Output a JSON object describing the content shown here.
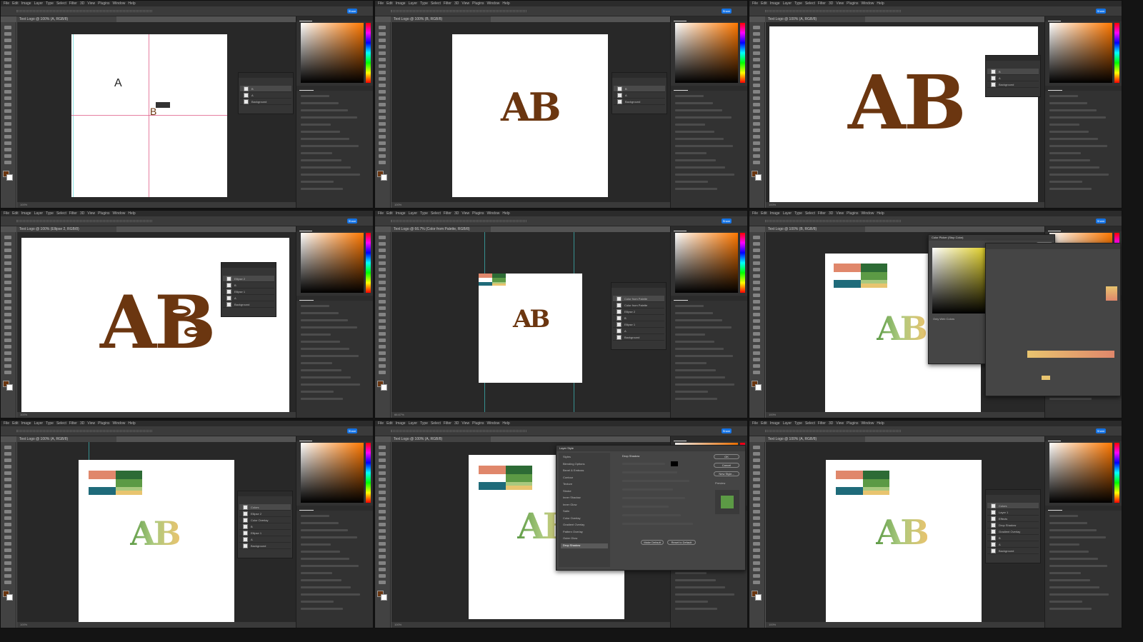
{
  "menu": [
    "File",
    "Edit",
    "Image",
    "Layer",
    "Type",
    "Select",
    "Filter",
    "3D",
    "View",
    "Plugins",
    "Window",
    "Help"
  ],
  "share_label": "Share",
  "panes": [
    {
      "tab": "Text Logo @ 100% (A, RGB/8)",
      "status": "100%",
      "layers": [
        "B",
        "A",
        "Background"
      ],
      "letters": {
        "a": "A",
        "b": "B"
      }
    },
    {
      "tab": "Text Logo @ 100% (B, RGB/8)",
      "status": "100%",
      "layers": [
        "B",
        "A",
        "Background"
      ],
      "logo": "AB"
    },
    {
      "tab": "Text Logo @ 100% (A, RGB/8)",
      "status": "100%",
      "layers": [
        "B",
        "A",
        "Background"
      ],
      "logo": "AB"
    },
    {
      "tab": "Text Logo @ 100% (Ellipse 2, RGB/8)",
      "status": "100%",
      "layers": [
        "Ellipse 2",
        "B",
        "Ellipse 1",
        "A",
        "Background"
      ],
      "logo": "AB"
    },
    {
      "tab": "Text Logo @ 66.7% (Color from Palette, RGB/8)",
      "status": "66.67%",
      "layers": [
        "Color from Palette",
        "Color from Palette",
        "Ellipse 2",
        "B",
        "Ellipse 1",
        "A",
        "Background"
      ],
      "logo": "AB"
    },
    {
      "tab": "Text Logo @ 100% (B, RGB/8)",
      "status": "100%",
      "logo": "AB",
      "dialog": {
        "title": "Color Picker (Stop Color)",
        "ok": "OK",
        "cancel": "Cancel",
        "add": "Add to Swatches",
        "libs": "Color Libraries",
        "only_web": "Only Web Colors",
        "hex": "E8C46F",
        "fields": [
          "H:",
          "S:",
          "B:",
          "R:",
          "G:",
          "B:"
        ]
      }
    },
    {
      "tab": "Text Logo @ 100% (A, RGB/8)",
      "status": "100%",
      "layers": [
        "Colors",
        "Ellipse 2",
        "Color Overlay",
        "B",
        "Ellipse 1",
        "A",
        "Background"
      ],
      "logo": "AB"
    },
    {
      "tab": "Text Logo @ 100% (A, RGB/8)",
      "status": "100%",
      "logo": "AB",
      "dialog": {
        "title": "Layer Style",
        "ok": "OK",
        "cancel": "Cancel",
        "new": "New Style...",
        "preview": "Preview",
        "items": [
          "Styles",
          "Blending Options",
          "Bevel & Emboss",
          "Contour",
          "Texture",
          "Stroke",
          "Inner Shadow",
          "Inner Glow",
          "Satin",
          "Color Overlay",
          "Gradient Overlay",
          "Pattern Overlay",
          "Outer Glow",
          "Drop Shadow"
        ],
        "section": "Drop Shadow",
        "make_default": "Make Default",
        "reset_default": "Reset to Default"
      }
    },
    {
      "tab": "Text Logo @ 100% (A, RGB/8)",
      "status": "100%",
      "layers": [
        "Colors",
        "Layer 1",
        "Effects",
        "Drop Shadow",
        "Gradient Overlay",
        "B",
        "A",
        "Background"
      ],
      "logo": "AB"
    }
  ],
  "palette_colors": {
    "salmon": "#e0876b",
    "teal": "#1f6b7a",
    "green_dark": "#2d6b35",
    "green_mid": "#5c9a45",
    "green_light": "#a9c97e",
    "sand": "#e8c46f"
  },
  "brand": {
    "brown": "#6b3610",
    "accent": "#1473e6"
  }
}
